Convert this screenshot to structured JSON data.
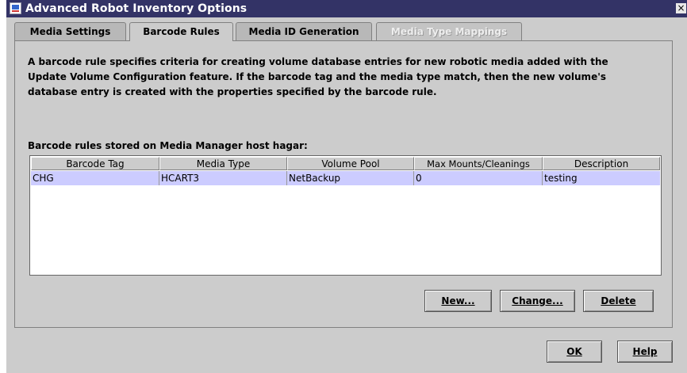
{
  "window": {
    "title": "Advanced Robot Inventory Options",
    "close_label": "×"
  },
  "tabs": [
    {
      "label": "Media Settings",
      "state": "normal"
    },
    {
      "label": "Barcode Rules",
      "state": "active"
    },
    {
      "label": "Media ID Generation",
      "state": "normal"
    },
    {
      "label": "Media Type Mappings",
      "state": "disabled"
    }
  ],
  "panel": {
    "description_lines": [
      "A barcode rule specifies criteria for creating volume database entries for new robotic media added with the",
      "Update Volume Configuration feature.  If the barcode tag and the media type match, then the new volume's",
      "database entry is created with the properties specified by the barcode rule."
    ],
    "stored_label": "Barcode rules stored on Media Manager host hagar:",
    "table": {
      "columns": [
        "Barcode Tag",
        "Media Type",
        "Volume Pool",
        "Max Mounts/Cleanings",
        "Description"
      ],
      "rows": [
        [
          "CHG",
          "HCART3",
          "NetBackup",
          "0",
          "testing"
        ]
      ]
    },
    "buttons": {
      "new": "New...",
      "change": "Change...",
      "delete": "Delete"
    }
  },
  "footer": {
    "ok": "OK",
    "help": "Help"
  },
  "colors": {
    "titlebar": "#333366",
    "selected_row": "#ccccff",
    "window_bg": "#cccccc"
  }
}
